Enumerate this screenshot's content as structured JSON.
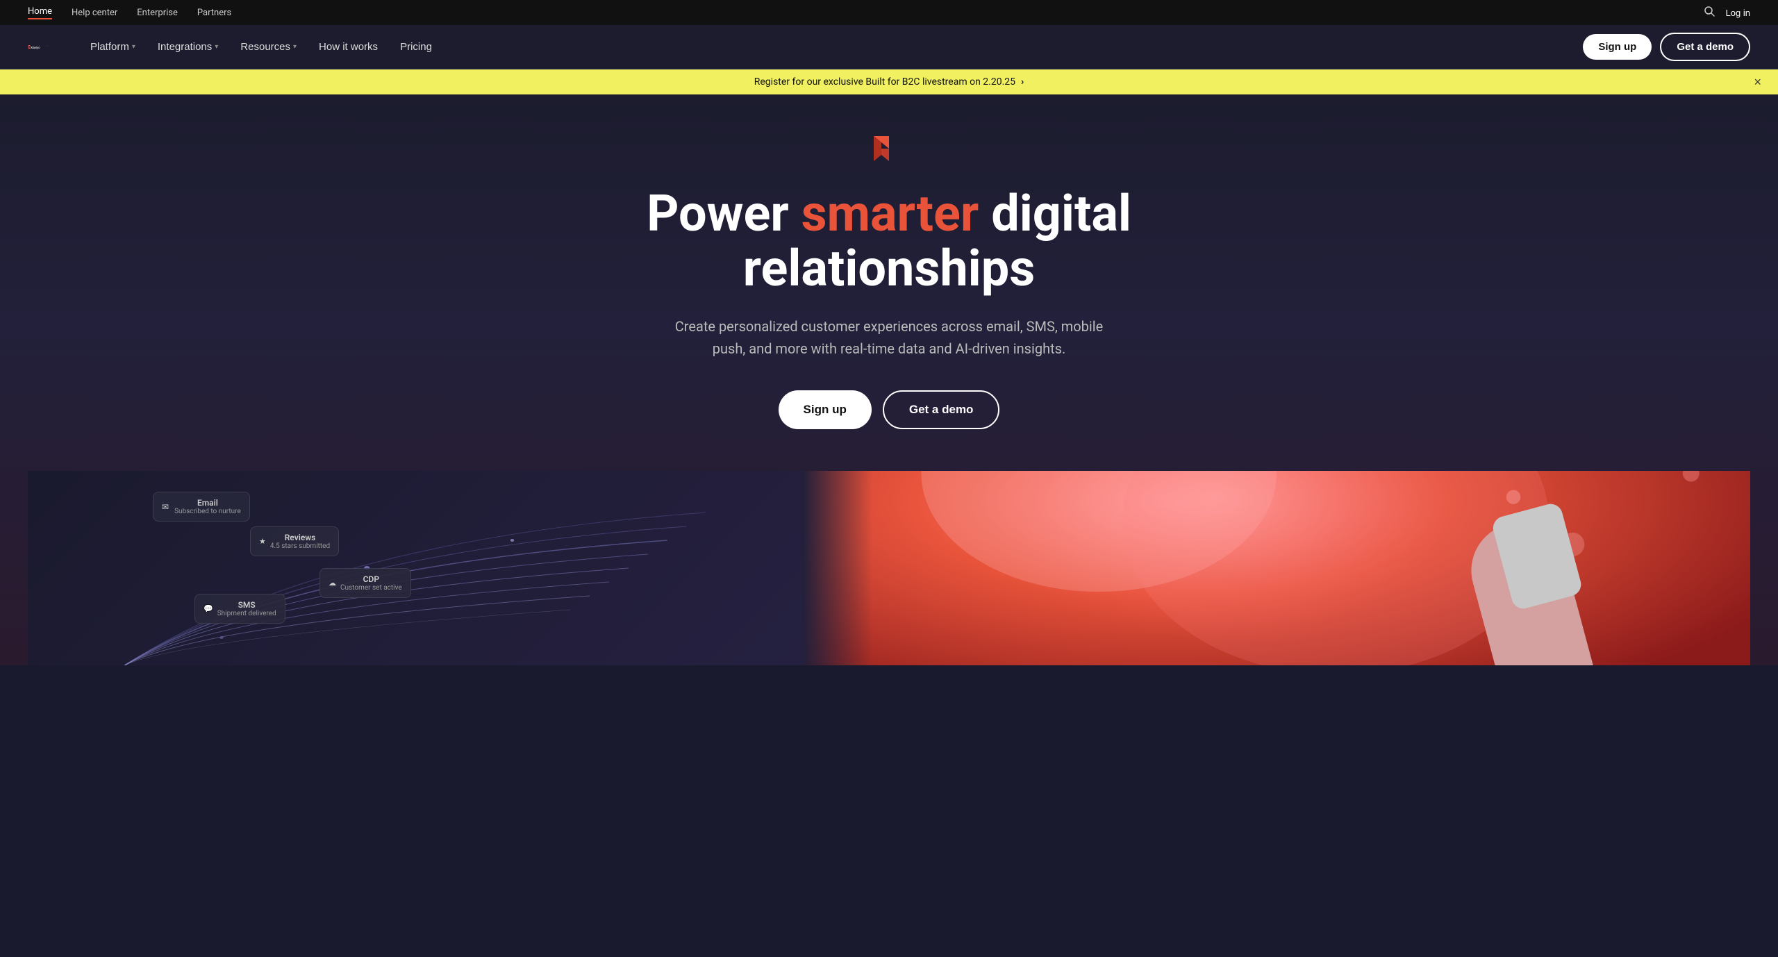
{
  "top_nav": {
    "links": [
      {
        "label": "Home",
        "active": true
      },
      {
        "label": "Help center",
        "active": false
      },
      {
        "label": "Enterprise",
        "active": false
      },
      {
        "label": "Partners",
        "active": false
      }
    ],
    "right": {
      "search_label": "search",
      "login_label": "Log in"
    }
  },
  "main_nav": {
    "logo": {
      "text": "klaviyo",
      "aria": "Klaviyo home"
    },
    "links": [
      {
        "label": "Platform",
        "has_dropdown": true
      },
      {
        "label": "Integrations",
        "has_dropdown": true
      },
      {
        "label": "Resources",
        "has_dropdown": true
      },
      {
        "label": "How it works",
        "has_dropdown": false
      },
      {
        "label": "Pricing",
        "has_dropdown": false
      }
    ],
    "cta": {
      "signup": "Sign up",
      "demo": "Get a demo"
    }
  },
  "banner": {
    "text": "Register for our exclusive Built for B2C livestream on 2.20.25",
    "arrow": "›",
    "close": "×"
  },
  "hero": {
    "title_start": "Power ",
    "title_accent": "smarter",
    "title_end": " digital relationships",
    "subtitle": "Create personalized customer experiences across email, SMS, mobile push, and more with real-time data and AI-driven insights.",
    "btn_signup": "Sign up",
    "btn_demo": "Get a demo"
  },
  "dashboard_cards": {
    "email": {
      "icon": "✉",
      "label": "Email",
      "sub": "Subscribed to nurture"
    },
    "reviews": {
      "icon": "★",
      "label": "Reviews",
      "sub": "4.5 stars submitted"
    },
    "cdp": {
      "icon": "☁",
      "label": "CDP",
      "sub": "Customer set active"
    },
    "sms": {
      "icon": "💬",
      "label": "SMS",
      "sub": "Shipment delivered"
    }
  },
  "colors": {
    "accent": "#e8533a",
    "banner_bg": "#f0f060",
    "hero_bg": "#1c1c2e",
    "logo_k_color": "#e8533a"
  }
}
